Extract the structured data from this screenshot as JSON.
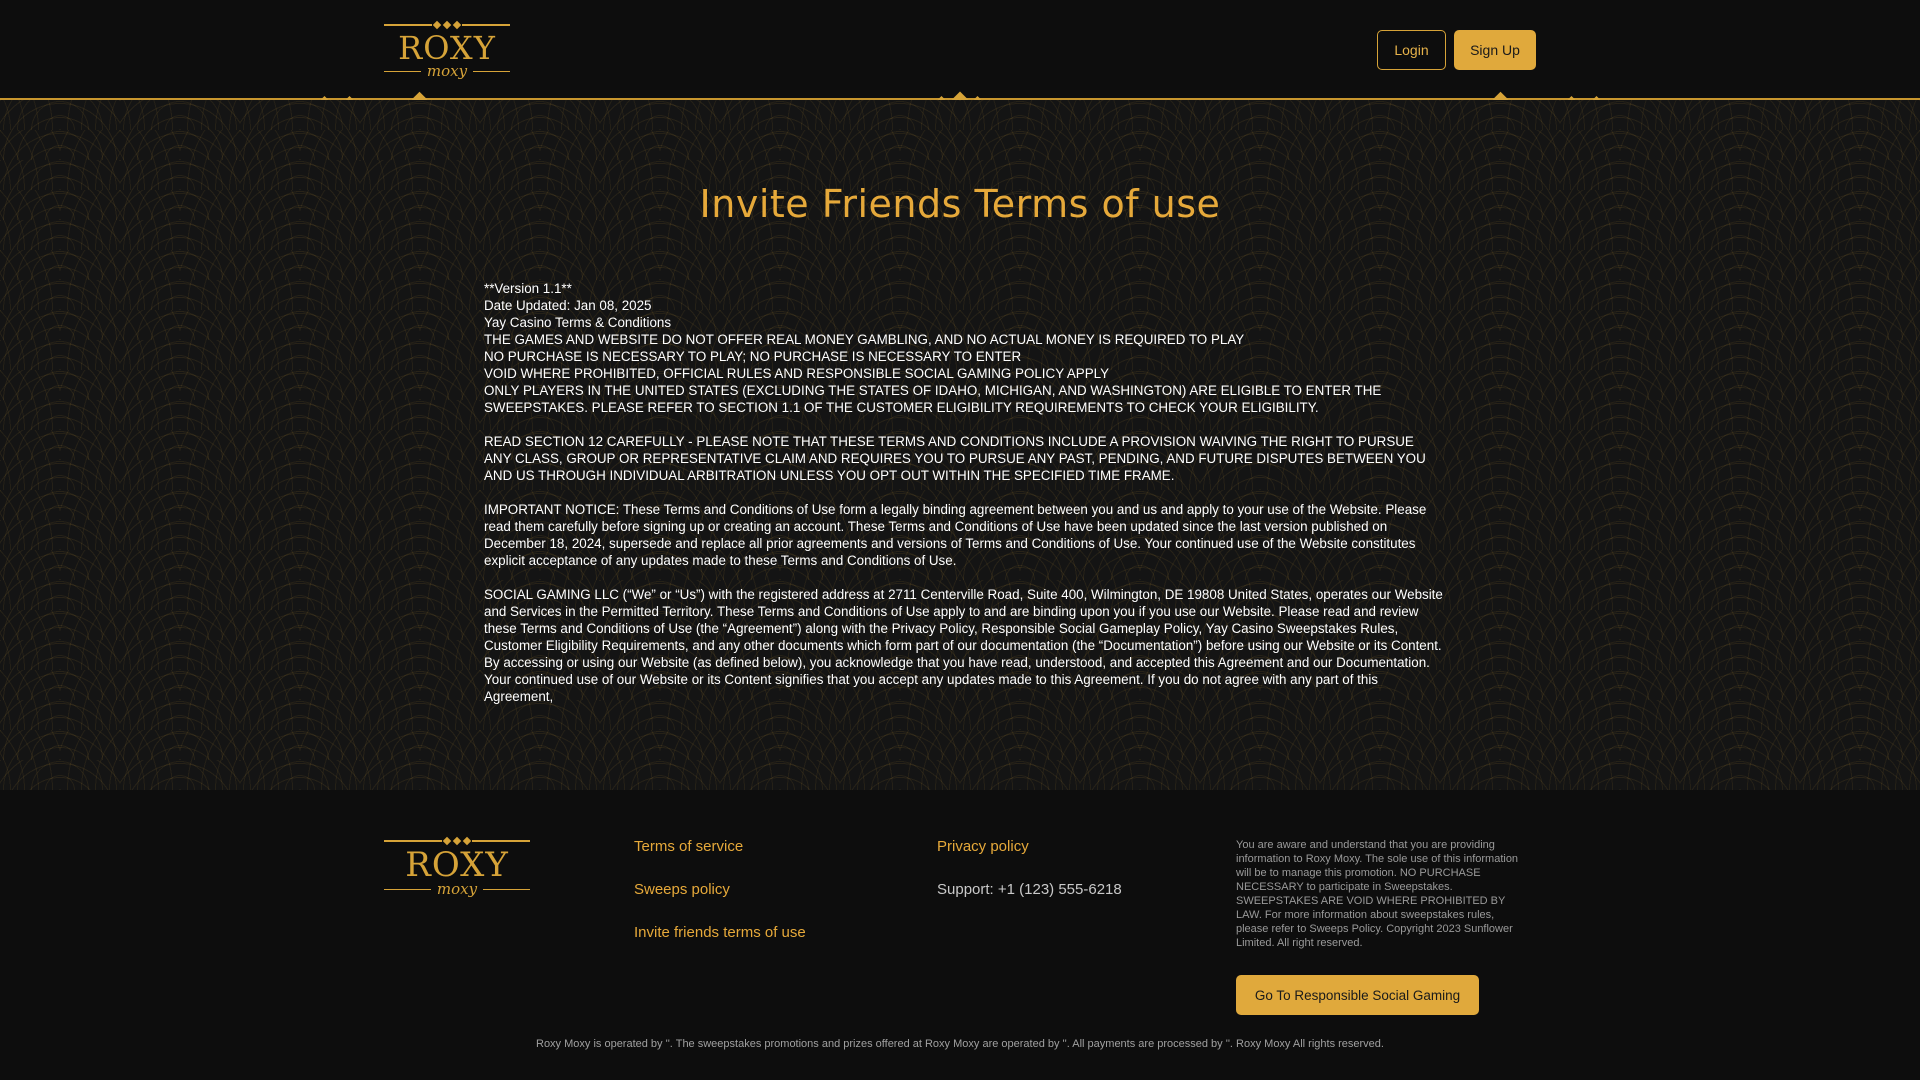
{
  "brand": {
    "logo_word": "ROXY",
    "logo_sub": "moxy",
    "accent_color": "#e0a93c"
  },
  "header": {
    "login_label": "Login",
    "signup_label": "Sign Up"
  },
  "main": {
    "title": "Invite Friends Terms of use",
    "lines_block1": [
      "**Version 1.1**",
      "Date Updated: Jan 08, 2025",
      "Yay Casino Terms & Conditions",
      "THE GAMES AND WEBSITE DO NOT OFFER REAL MONEY GAMBLING, AND NO ACTUAL MONEY IS REQUIRED TO PLAY",
      "NO PURCHASE IS NECESSARY TO PLAY; NO PURCHASE IS NECESSARY TO ENTER",
      "VOID WHERE PROHIBITED, OFFICIAL RULES AND RESPONSIBLE SOCIAL GAMING POLICY APPLY",
      "ONLY PLAYERS IN THE UNITED STATES (EXCLUDING THE STATES OF IDAHO, MICHIGAN, AND WASHINGTON) ARE ELIGIBLE TO ENTER THE SWEEPSTAKES. PLEASE REFER TO SECTION 1.1 OF THE CUSTOMER ELIGIBILITY REQUIREMENTS TO CHECK YOUR ELIGIBILITY."
    ],
    "para_arbitration": "READ SECTION 12 CAREFULLY - PLEASE NOTE THAT THESE TERMS AND CONDITIONS INCLUDE A PROVISION WAIVING THE RIGHT TO PURSUE ANY CLASS, GROUP OR REPRESENTATIVE CLAIM AND REQUIRES YOU TO PURSUE ANY PAST, PENDING, AND FUTURE DISPUTES BETWEEN YOU AND US THROUGH INDIVIDUAL ARBITRATION UNLESS YOU OPT OUT WITHIN THE SPECIFIED TIME FRAME.",
    "para_notice": "IMPORTANT NOTICE: These Terms and Conditions of Use form a legally binding agreement between you and us and apply to your use of the Website. Please read them carefully before signing up or creating an account. These Terms and Conditions of Use have been updated since the last version published on December 18, 2024, supersede and replace all prior agreements and versions of Terms and Conditions of Use. Your continued use of the Website constitutes explicit acceptance of any updates made to these Terms and Conditions of Use.",
    "para_company": "SOCIAL GAMING LLC (“We” or “Us”) with the registered address at 2711 Centerville Road, Suite 400, Wilmington, DE 19808 United States, operates our Website and Services in the Permitted Territory. These Terms and Conditions of Use apply to and are binding upon you if you use our Website. Please read and review these Terms and Conditions of Use (the “Agreement”) along with the Privacy Policy, Responsible Social Gameplay Policy, Yay Casino Sweepstakes Rules, Customer Eligibility Requirements, and any other documents which form part of our documentation (the “Documentation”) before using our Website or its Content. By accessing or using our Website (as defined below), you acknowledge that you have read, understood, and accepted this Agreement and our Documentation. Your continued use of our Website or its Content signifies that you accept any updates made to this Agreement. If you do not agree with any part of this Agreement,"
  },
  "footer": {
    "links": {
      "terms": "Terms of service",
      "sweeps": "Sweeps policy",
      "invite": "Invite friends terms of use",
      "privacy": "Privacy policy"
    },
    "support": "Support: +1 (123) 555-6218",
    "disclaimer": "You are aware and understand that you are providing information to Roxy Moxy. The sole use of this information will be to manage this promotion. NO PURCHASE NECESSARY to participate in Sweepstakes. SWEEPSTAKES ARE VOID WHERE PROHIBITED BY LAW. For more information about sweepstakes rules, please refer to Sweeps Policy. Copyright 2023 Sunflower Limited. All right reserved.",
    "rsg_button": "Go To Responsible Social Gaming",
    "copyright": "Roxy Moxy is operated by ''. The sweepstakes promotions and prizes offered at Roxy Moxy are operated by ''. All payments are processed by ''. Roxy Moxy All rights reserved."
  }
}
